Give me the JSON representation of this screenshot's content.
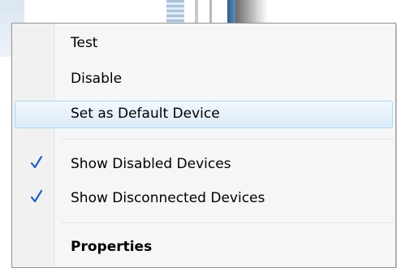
{
  "context_menu": {
    "items": [
      {
        "label": "Test",
        "checked": false,
        "bold": false,
        "highlighted": false
      },
      {
        "label": "Disable",
        "checked": false,
        "bold": false,
        "highlighted": false
      },
      {
        "label": "Set as Default Device",
        "checked": false,
        "bold": false,
        "highlighted": true
      },
      {
        "label": "Show Disabled Devices",
        "checked": true,
        "bold": false,
        "highlighted": false
      },
      {
        "label": "Show Disconnected Devices",
        "checked": true,
        "bold": false,
        "highlighted": false
      },
      {
        "label": "Properties",
        "checked": false,
        "bold": true,
        "highlighted": false
      }
    ]
  },
  "colors": {
    "check": "#1f5fc4",
    "highlight_border": "#a8d8f0",
    "menu_background": "#f5f6f7"
  },
  "icons": {
    "check": "check-icon"
  }
}
